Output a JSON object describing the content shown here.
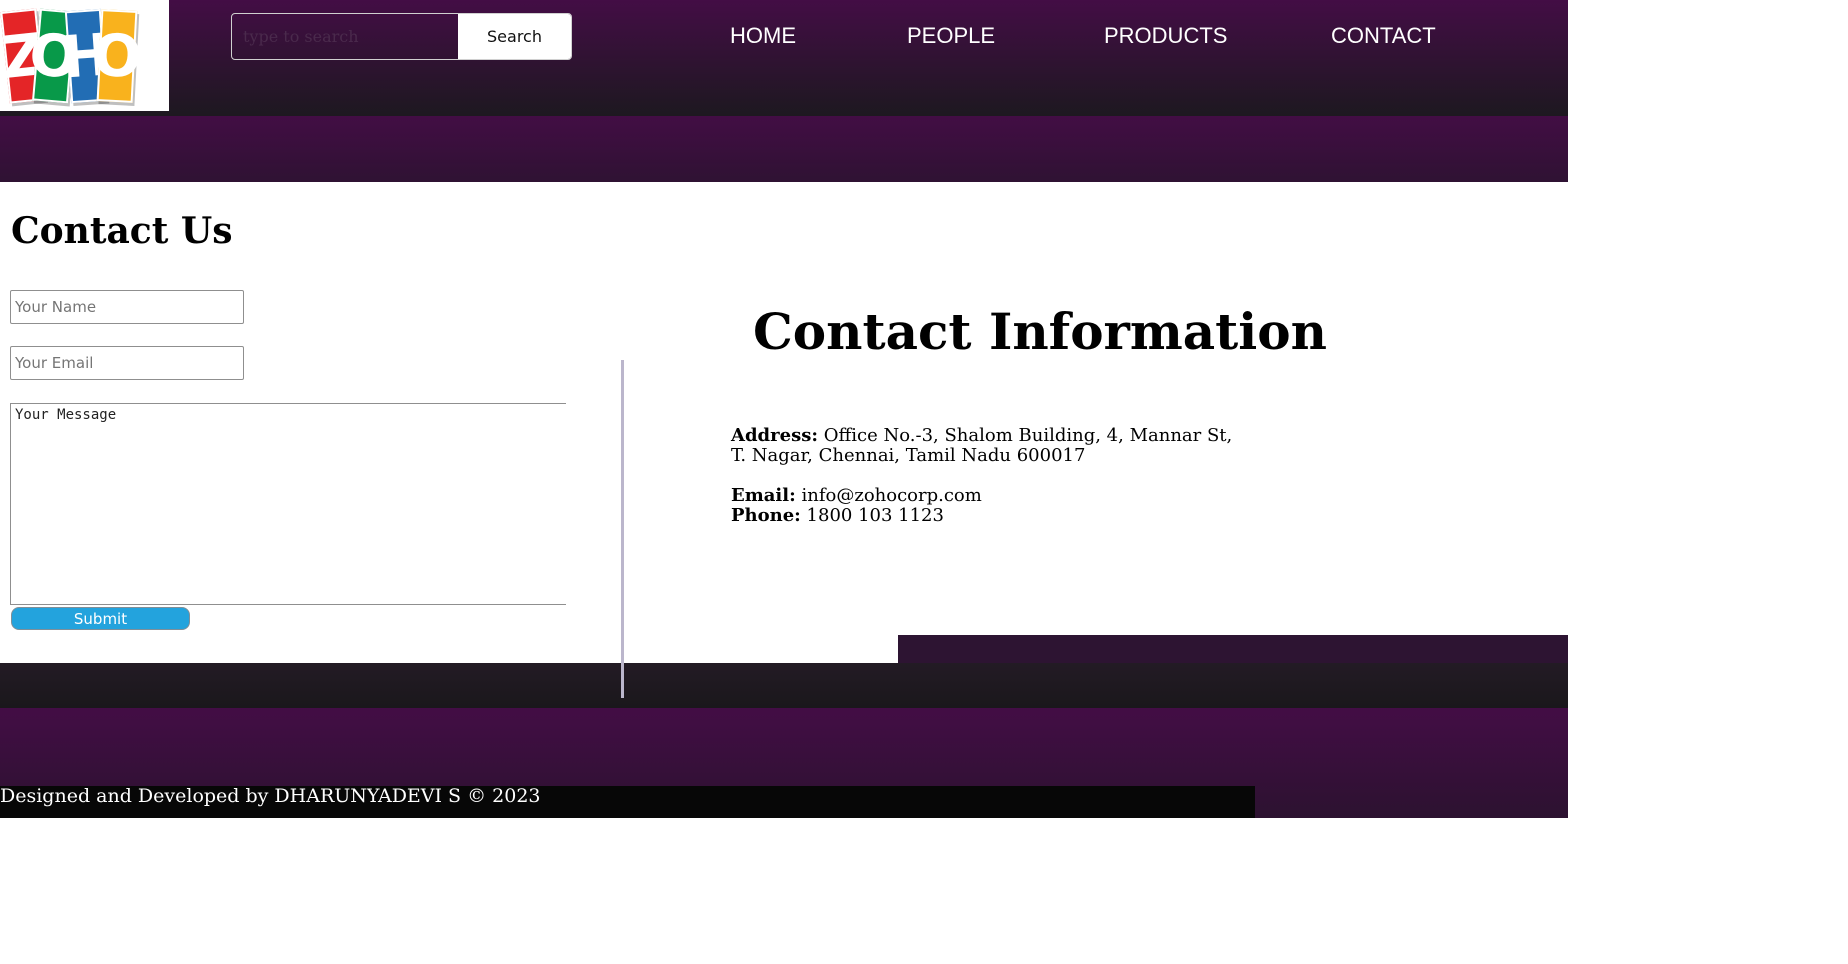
{
  "logo": {
    "letters": [
      "Z",
      "O",
      "H",
      "O"
    ],
    "colors": [
      "#e42527",
      "#089949",
      "#226db4",
      "#f9b21d"
    ]
  },
  "search": {
    "placeholder": "type to search",
    "button_label": "Search"
  },
  "nav": {
    "items": [
      "HOME",
      "PEOPLE",
      "PRODUCTS",
      "CONTACT"
    ]
  },
  "contact_form": {
    "title": "Contact Us",
    "name_placeholder": "Your Name",
    "email_placeholder": "Your Email",
    "message_placeholder": "Your Message",
    "submit_label": "Submit"
  },
  "contact_info": {
    "title": "Contact Information",
    "address_label": "Address:",
    "address_value": "Office No.-3, Shalom Building, 4, Mannar St, T. Nagar, Chennai, Tamil Nadu 600017",
    "email_label": "Email:",
    "email_value": "info@zohocorp.com",
    "phone_label": "Phone:",
    "phone_value": "1800 103 1123"
  },
  "footer": {
    "text": "Designed and Developed by DHARUNYADEVI S © 2023"
  },
  "colors": {
    "header": "#430d45",
    "dark": "#1d1820",
    "submit": "#23a3dd"
  }
}
